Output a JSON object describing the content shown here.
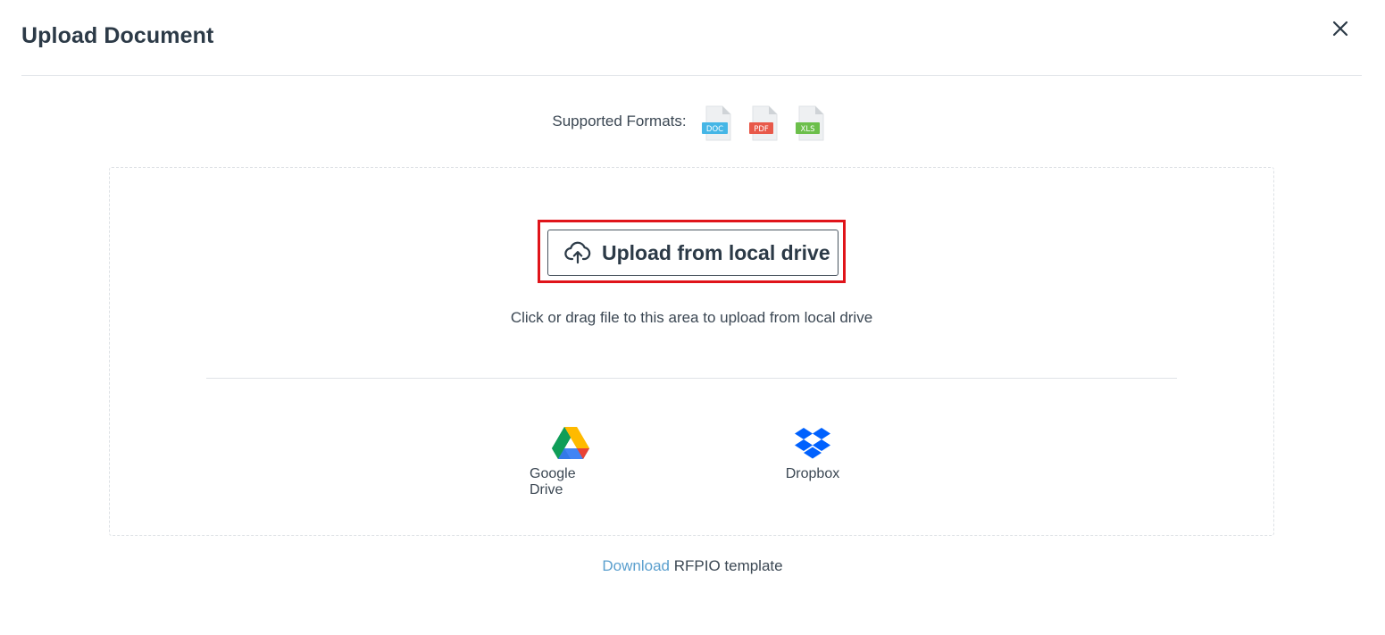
{
  "modal": {
    "title": "Upload Document"
  },
  "formats": {
    "label": "Supported Formats:",
    "items": [
      {
        "tag": "DOC",
        "color": "#45b6e6"
      },
      {
        "tag": "PDF",
        "color": "#e8594a"
      },
      {
        "tag": "XLS",
        "color": "#6cbf4b"
      }
    ]
  },
  "upload": {
    "button_label": "Upload from local drive",
    "hint": "Click or drag file to this area to upload from local drive",
    "highlight_color": "#e0141a"
  },
  "providers": [
    {
      "name": "Google Drive",
      "icon": "google-drive-icon"
    },
    {
      "name": "Dropbox",
      "icon": "dropbox-icon",
      "color": "#0061fe"
    }
  ],
  "footer": {
    "link_text": "Download",
    "rest_text": " RFPIO template"
  }
}
